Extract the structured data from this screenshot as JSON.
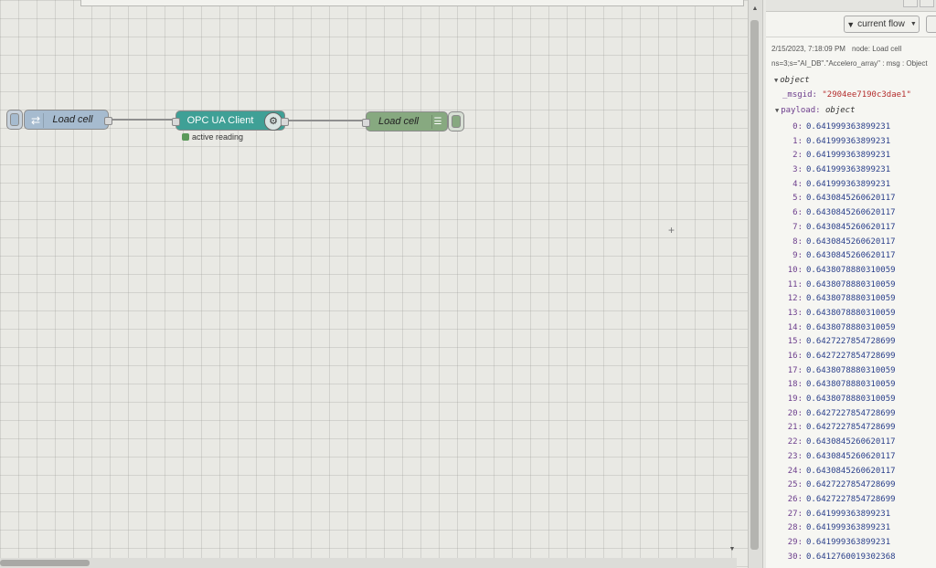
{
  "flow": {
    "nodes": {
      "inject": {
        "label": "Load cell"
      },
      "opcua": {
        "label": "OPC UA Client",
        "status": "active reading"
      },
      "debug": {
        "label": "Load cell"
      }
    }
  },
  "sidebar": {
    "filter_label": "current flow",
    "message": {
      "timestamp": "2/15/2023, 7:18:09 PM",
      "node_label": "node: Load cell",
      "topic_line": "ns=3;s=\"AI_DB\".\"Accelero_array\" : msg : Object",
      "root_type": "object",
      "msgid_key": "_msgid:",
      "msgid_value": "\"2904ee7190c3dae1\"",
      "payload_key": "payload:",
      "payload_type": "object",
      "payload": [
        {
          "i": "0:",
          "v": "0.641999363899231"
        },
        {
          "i": "1:",
          "v": "0.641999363899231"
        },
        {
          "i": "2:",
          "v": "0.641999363899231"
        },
        {
          "i": "3:",
          "v": "0.641999363899231"
        },
        {
          "i": "4:",
          "v": "0.641999363899231"
        },
        {
          "i": "5:",
          "v": "0.6430845260620117"
        },
        {
          "i": "6:",
          "v": "0.6430845260620117"
        },
        {
          "i": "7:",
          "v": "0.6430845260620117"
        },
        {
          "i": "8:",
          "v": "0.6430845260620117"
        },
        {
          "i": "9:",
          "v": "0.6430845260620117"
        },
        {
          "i": "10:",
          "v": "0.6438078880310059"
        },
        {
          "i": "11:",
          "v": "0.6438078880310059"
        },
        {
          "i": "12:",
          "v": "0.6438078880310059"
        },
        {
          "i": "13:",
          "v": "0.6438078880310059"
        },
        {
          "i": "14:",
          "v": "0.6438078880310059"
        },
        {
          "i": "15:",
          "v": "0.6427227854728699"
        },
        {
          "i": "16:",
          "v": "0.6427227854728699"
        },
        {
          "i": "17:",
          "v": "0.6438078880310059"
        },
        {
          "i": "18:",
          "v": "0.6438078880310059"
        },
        {
          "i": "19:",
          "v": "0.6438078880310059"
        },
        {
          "i": "20:",
          "v": "0.6427227854728699"
        },
        {
          "i": "21:",
          "v": "0.6427227854728699"
        },
        {
          "i": "22:",
          "v": "0.6430845260620117"
        },
        {
          "i": "23:",
          "v": "0.6430845260620117"
        },
        {
          "i": "24:",
          "v": "0.6430845260620117"
        },
        {
          "i": "25:",
          "v": "0.6427227854728699"
        },
        {
          "i": "26:",
          "v": "0.6427227854728699"
        },
        {
          "i": "27:",
          "v": "0.641999363899231"
        },
        {
          "i": "28:",
          "v": "0.641999363899231"
        },
        {
          "i": "29:",
          "v": "0.641999363899231"
        },
        {
          "i": "30:",
          "v": "0.6412760019302368"
        }
      ]
    }
  },
  "icons": {
    "inject": "inject-arrows-icon",
    "opcua": "opcua-gear-icon",
    "debug": "debug-list-icon",
    "filter": "funnel-icon"
  },
  "colors": {
    "inject_node": "#a6bbcf",
    "opcua_node": "#3fa096",
    "debug_node": "#87a980",
    "status_dot": "#5a9a5a",
    "payload_number": "#2a3f8a",
    "msgid_string": "#b42d2d"
  }
}
